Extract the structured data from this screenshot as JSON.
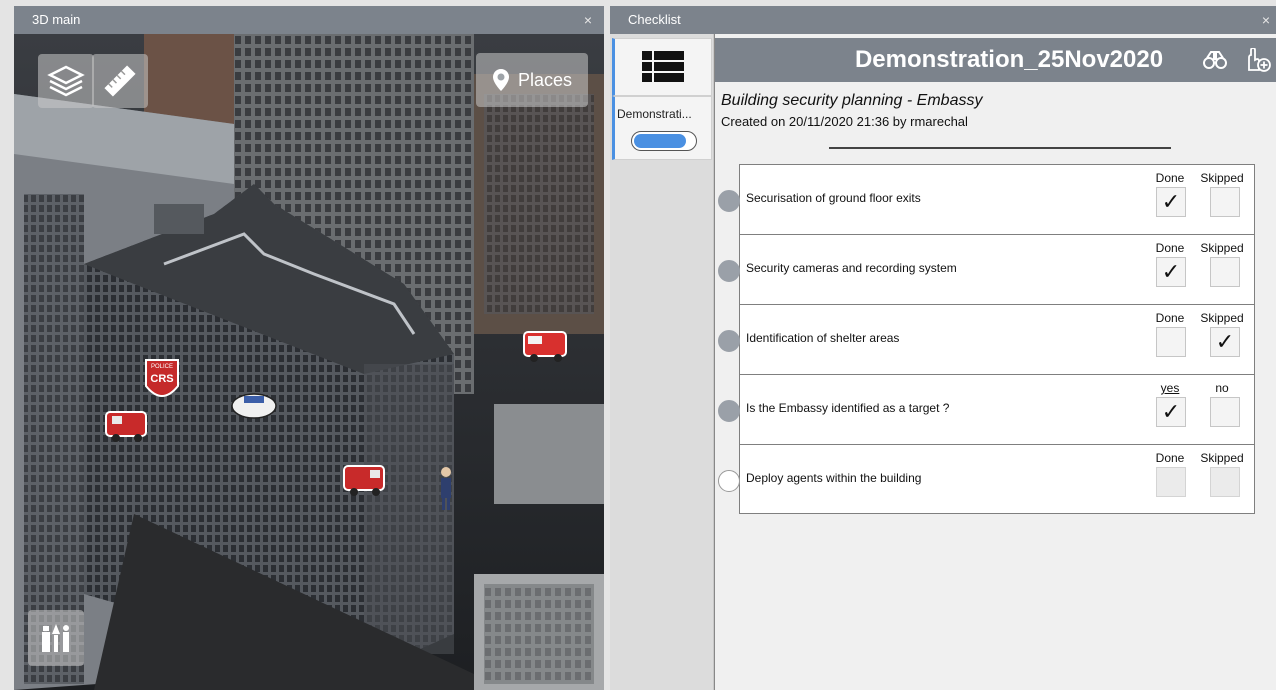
{
  "view3d": {
    "title": "3D main",
    "close_glyph": "×",
    "buttons": {
      "layers_icon": "layers-icon",
      "ruler_icon": "ruler-icon",
      "places_label": "Places",
      "places_icon": "map-pin-icon",
      "tools_icon": "tools-icon"
    },
    "markers": {
      "crs_badge_text": "CRS",
      "crs_badge_top_text": "POLICE"
    }
  },
  "checklist": {
    "window_title": "Checklist",
    "close_glyph": "×",
    "sidebar": {
      "list_icon": "list-icon",
      "item_label": "Demonstrati...",
      "item_progress": 0.86
    },
    "header": {
      "title": "Demonstration_25Nov2020",
      "icon1": "binoculars-icon",
      "icon2": "add-hand-icon"
    },
    "subtitle": "Building security planning - Embassy",
    "created": "Created on 20/11/2020 21:36 by rmarechal",
    "check_glyph": "✓",
    "items": [
      {
        "label": "Securisation of ground floor exits",
        "opt1": "Done",
        "opt2": "Skipped",
        "state": "done",
        "complete": true
      },
      {
        "label": "Security cameras and recording system",
        "opt1": "Done",
        "opt2": "Skipped",
        "state": "done",
        "complete": true
      },
      {
        "label": "Identification of shelter areas",
        "opt1": "Done",
        "opt2": "Skipped",
        "state": "skipped",
        "complete": true
      },
      {
        "label": "Is the Embassy identified as a target ?",
        "opt1": "yes",
        "opt2": "no",
        "state": "yes",
        "complete": true
      },
      {
        "label": "Deploy agents within the building",
        "opt1": "Done",
        "opt2": "Skipped",
        "state": "none",
        "complete": false
      }
    ]
  }
}
